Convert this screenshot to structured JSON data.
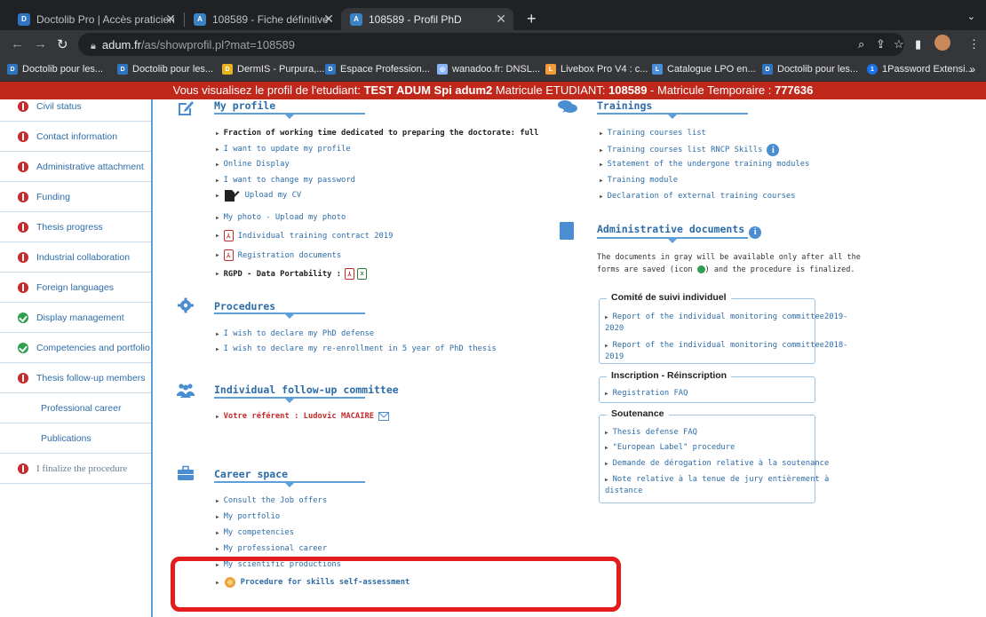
{
  "browser": {
    "tabs": [
      {
        "title": "Doctolib Pro | Accès praticiens",
        "icon": "doctolib-icon",
        "color": "#2f74c0"
      },
      {
        "title": "108589 - Fiche définitive",
        "icon": "adum-icon",
        "color": "#3b82c4"
      },
      {
        "title": "108589 - Profil PhD",
        "icon": "adum-icon",
        "color": "#3b82c4"
      }
    ],
    "url_host": "adum.fr",
    "url_path": "/as/showprofil.pl?mat=108589",
    "bookmarks": [
      "Doctolib pour les...",
      "Doctolib pour les...",
      "DermIS - Purpura,...",
      "Espace Profession...",
      "wanadoo.fr: DNSL...",
      "Livebox Pro V4 : c...",
      "Catalogue LPO en...",
      "Doctolib pour les...",
      "1Password Extensi..."
    ]
  },
  "banner": {
    "prefix": "Vous visualisez le profil de l'etudiant: ",
    "name": "TEST ADUM Spi adum2",
    "matricule_label": " Matricule ETUDIANT: ",
    "matricule": "108589",
    "temp_label": " - Matricule Temporaire : ",
    "temp": "777636"
  },
  "sidebar": [
    {
      "label": "Civil status",
      "status": "red"
    },
    {
      "label": "Contact information",
      "status": "red"
    },
    {
      "label": "Administrative attachment",
      "status": "red"
    },
    {
      "label": "Funding",
      "status": "red"
    },
    {
      "label": "Thesis progress",
      "status": "red"
    },
    {
      "label": "Industrial collaboration",
      "status": "red"
    },
    {
      "label": "Foreign languages",
      "status": "red"
    },
    {
      "label": "Display management",
      "status": "green"
    },
    {
      "label": "Competencies and portfolio",
      "status": "green"
    },
    {
      "label": "Thesis follow-up members",
      "status": "red"
    },
    {
      "label": "Professional career",
      "status": "none"
    },
    {
      "label": "Publications",
      "status": "none"
    },
    {
      "label": "I finalize the procedure",
      "status": "red"
    }
  ],
  "profile": {
    "title": "My profile",
    "fraction": "Fraction of working time dedicated to preparing the doctorate: full",
    "update": "I want to update my profile",
    "online": "Online Display",
    "password": "I want to change my password",
    "cv": "Upload my CV",
    "photo": "My photo - Upload my photo",
    "contract": "Individual training contract 2019",
    "registration": "Registration documents",
    "rgpd": "RGPD - Data Portability :"
  },
  "procedures": {
    "title": "Procedures",
    "defense": "I wish to declare my PhD defense",
    "reenroll": "I wish to declare my re-enrollment in 5 year of PhD thesis"
  },
  "committee": {
    "title": "Individual follow-up committee",
    "referent": "Votre référent : Ludovic MACAIRE"
  },
  "career": {
    "title": "Career space",
    "items": [
      "Consult the Job offers",
      "My portfolio",
      "My competencies",
      "My professional career",
      "My scientific productions"
    ],
    "self_assessment": "Procedure for skills self-assessment"
  },
  "trainings": {
    "title": "Trainings",
    "items": [
      "Training courses list",
      "Training courses list RNCP Skills",
      "Statement of the undergone training modules",
      "Training module",
      "Declaration of external training courses"
    ]
  },
  "admin_docs": {
    "title": "Administrative documents",
    "note_line1": "The documents in gray will be available only after all the",
    "note_line2a": "forms are saved (icon ",
    "note_line2b": ") and the procedure is finalized."
  },
  "comite": {
    "legend": "Comité de suivi individuel",
    "item1_l1": "Report of the individual monitoring committee2019-",
    "item1_l2": "2020",
    "item2_l1": "Report of the individual monitoring committee2018-",
    "item2_l2": "2019"
  },
  "inscription": {
    "legend": "Inscription - Réinscription",
    "faq": "Registration FAQ"
  },
  "soutenance": {
    "legend": "Soutenance",
    "items": [
      "Thesis defense FAQ",
      "\"European Label\" procedure",
      "Demande de dérogation relative à la soutenance",
      "Note relative à la tenue de jury entièrement à"
    ],
    "item4_l2": "distance"
  },
  "colors": {
    "accent": "#2d6ca8",
    "banner": "#c0281c",
    "status_red": "#c62a2a",
    "status_green": "#2e9e4f",
    "highlight": "#e41b1b"
  }
}
